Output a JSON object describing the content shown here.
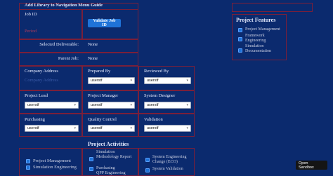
{
  "title": "Add Library to Navigation Menu Guide",
  "job_id_label": "Job ID",
  "period_label": "Period",
  "validate_button": "Validate Job ID",
  "selected_deliverable_label": "Selected Deliverable:",
  "selected_deliverable_value": "None",
  "parent_job_label": "Parent Job:",
  "parent_job_value": "None",
  "company_address_label": "Company Address",
  "company_address_value": "Company Address",
  "prepared_by_label": "Prepared By",
  "prepared_by_value": "userstf",
  "reviewed_by_label": "Reviewed By",
  "reviewed_by_value": "userstf",
  "project_lead_label": "Project Lead",
  "project_lead_value": "userstf",
  "project_manager_label": "Project Manager",
  "project_manager_value": "userstf",
  "system_designer_label": "System Designer",
  "system_designer_value": "userstf",
  "purchasing_label": "Purchasing",
  "purchasing_value": "userstf",
  "quality_control_label": "Quality Control",
  "quality_control_value": "userstf",
  "validation_label": "Validation",
  "validation_value": "userstf",
  "project_features": {
    "title": "Project Features",
    "items": [
      "Project Management",
      "Framework Engineering",
      "Simulation Documentation"
    ]
  },
  "project_activities": {
    "title": "Project Activities",
    "col1": [
      "Project Management",
      "Simulation Engineering"
    ],
    "col2": [
      "Simulation Methodology Report",
      "Purchasing",
      "QPP Engineering"
    ],
    "col3": [
      "System Engineering Change (ECO)",
      "System Validation"
    ]
  },
  "sandbox": {
    "line1": "Open",
    "line2": "Sandbox"
  }
}
